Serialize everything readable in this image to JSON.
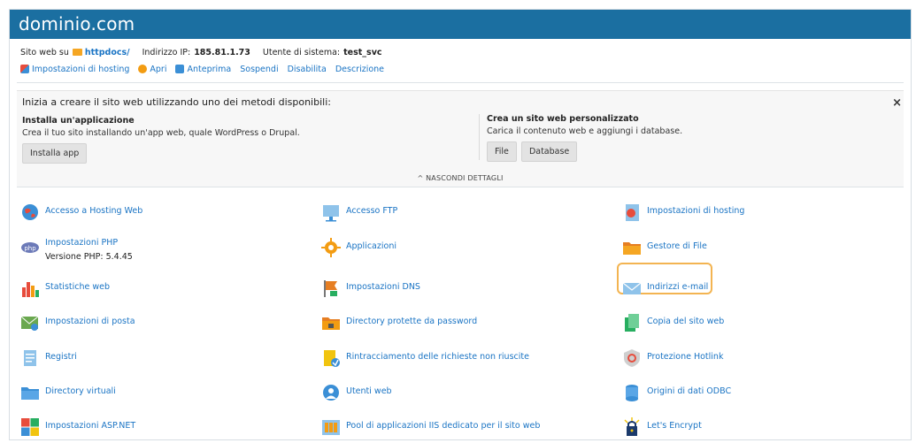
{
  "header": {
    "title": "dominio.com"
  },
  "info": {
    "site_label": "Sito web su",
    "site_folder": "httpdocs/",
    "ip_label": "Indirizzo IP:",
    "ip_value": "185.81.1.73",
    "user_label": "Utente di sistema:",
    "user_value": "test_svc"
  },
  "links": [
    {
      "label": "Impostazioni di hosting",
      "icon": "settings-icon"
    },
    {
      "label": "Apri",
      "icon": "open-icon"
    },
    {
      "label": "Anteprima",
      "icon": "preview-icon"
    },
    {
      "label": "Sospendi"
    },
    {
      "label": "Disabilita"
    },
    {
      "label": "Descrizione"
    }
  ],
  "promo": {
    "title": "Inizia a creare il sito web utilizzando uno dei metodi disponibili:",
    "left_heading": "Installa un'applicazione",
    "left_text": "Crea il tuo sito installando un'app web, quale WordPress o Drupal.",
    "left_button": "Installa app",
    "right_heading": "Crea un sito web personalizzato",
    "right_text": "Carica il contenuto web e aggiungi i database.",
    "right_button_file": "File",
    "right_button_db": "Database",
    "hide_label": "^ NASCONDI DETTAGLI",
    "close_label": "×"
  },
  "grid": {
    "col1": [
      {
        "label": "Accesso a Hosting Web",
        "icon": "globe-icon"
      },
      {
        "label": "Impostazioni PHP",
        "sub": "Versione PHP: 5.4.45",
        "icon": "php-icon"
      },
      {
        "label": "Statistiche web",
        "icon": "bar-chart-icon"
      },
      {
        "label": "Impostazioni di posta",
        "icon": "mail-settings-icon"
      },
      {
        "label": "Registri",
        "icon": "logs-icon"
      },
      {
        "label": "Directory virtuali",
        "icon": "folder-icon"
      },
      {
        "label": "Impostazioni ASP.NET",
        "icon": "windows-icon"
      }
    ],
    "col2": [
      {
        "label": "Accesso FTP",
        "icon": "ftp-icon"
      },
      {
        "label": "Applicazioni",
        "icon": "gear-icon"
      },
      {
        "label": "Impostazioni DNS",
        "icon": "dns-icon"
      },
      {
        "label": "Directory protette da password",
        "icon": "locked-folder-icon"
      },
      {
        "label": "Rintracciamento delle richieste non riuscite",
        "icon": "request-trace-icon"
      },
      {
        "label": "Utenti web",
        "icon": "web-users-icon"
      },
      {
        "label": "Pool di applicazioni IIS dedicato per il sito web",
        "icon": "app-pool-icon"
      }
    ],
    "col3": [
      {
        "label": "Impostazioni di hosting",
        "icon": "hosting-settings-icon"
      },
      {
        "label": "Gestore di File",
        "icon": "file-manager-icon"
      },
      {
        "label": "Indirizzi e-mail",
        "icon": "envelope-icon"
      },
      {
        "label": "Copia del sito web",
        "icon": "copy-site-icon"
      },
      {
        "label": "Protezione Hotlink",
        "icon": "hotlink-icon"
      },
      {
        "label": "Origini di dati ODBC",
        "icon": "database-icon"
      },
      {
        "label": "Let's Encrypt",
        "icon": "lock-icon"
      }
    ]
  },
  "colors": {
    "header": "#1b6fa1",
    "link": "#1a74c4",
    "highlight": "#f3b451"
  }
}
